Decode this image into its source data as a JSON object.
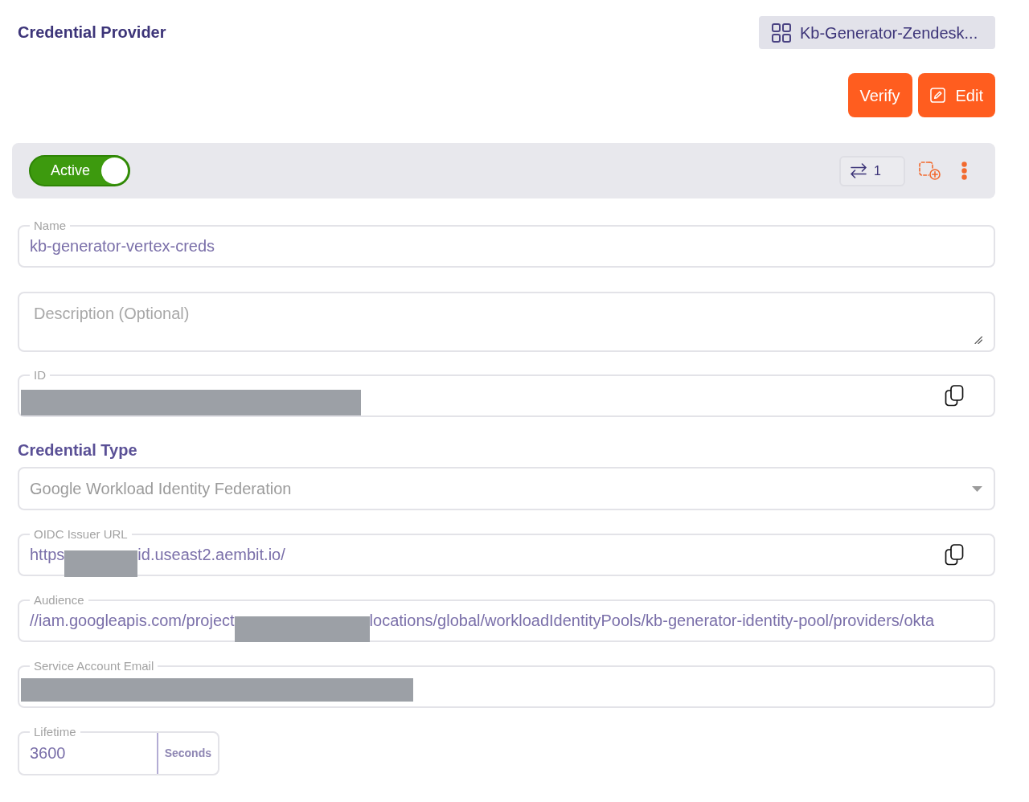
{
  "header": {
    "title": "Credential Provider",
    "chip": "Kb-Generator-Zendesk..."
  },
  "actions": [
    {
      "kind": "verify",
      "label": "Verify"
    },
    {
      "kind": "edit",
      "label": "Edit"
    }
  ],
  "status_bar": {
    "toggle": {
      "label": "Active",
      "on": true
    },
    "link_count": "1"
  },
  "form": {
    "name": {
      "label": "Name",
      "copyable": false,
      "value": [
        {
          "kind": "text",
          "text": "kb-generator-vertex-creds"
        }
      ]
    },
    "description": {
      "placeholder": "Description (Optional)"
    },
    "id": {
      "label": "ID",
      "copyable": true,
      "value": [
        {
          "kind": "redacted"
        }
      ]
    },
    "credential_type": {
      "heading": "Credential Type",
      "selected_option": "Google Workload Identity Federation"
    },
    "oidc_issuer_url": {
      "label": "OIDC Issuer URL",
      "copyable": true,
      "value": [
        {
          "kind": "text",
          "text": "https"
        },
        {
          "kind": "redacted"
        },
        {
          "kind": "text",
          "text": "id.useast2.aembit.io/"
        }
      ]
    },
    "audience": {
      "label": "Audience",
      "copyable": false,
      "value": [
        {
          "kind": "text",
          "text": "//iam.googleapis.com/project"
        },
        {
          "kind": "redacted"
        },
        {
          "kind": "text",
          "text": "locations/global/workloadIdentityPools/kb-generator-identity-pool/providers/okta"
        }
      ]
    },
    "service_account_email": {
      "label": "Service Account Email",
      "copyable": false,
      "value": [
        {
          "kind": "redacted"
        }
      ]
    },
    "lifetime": {
      "label": "Lifetime",
      "value": "3600",
      "unit": "Seconds"
    }
  }
}
